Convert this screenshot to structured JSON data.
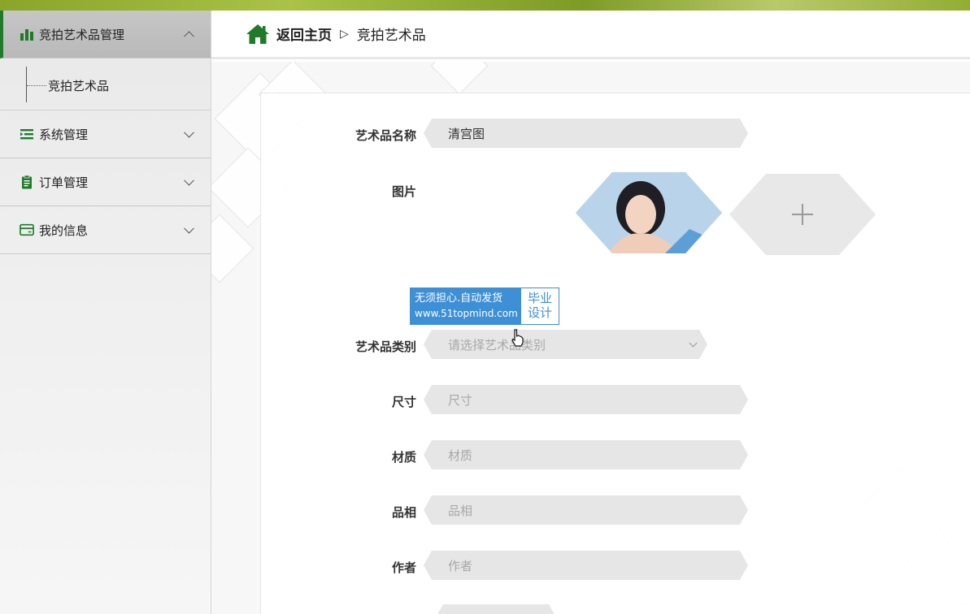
{
  "sidebar": {
    "menus": [
      {
        "label": "竞拍艺术品管理",
        "icon": "bar-chart-icon",
        "expanded": true,
        "children": [
          {
            "label": "竞拍艺术品"
          }
        ]
      },
      {
        "label": "系统管理",
        "icon": "list-indent-icon",
        "expanded": false
      },
      {
        "label": "订单管理",
        "icon": "clipboard-icon",
        "expanded": false
      },
      {
        "label": "我的信息",
        "icon": "card-icon",
        "expanded": false
      }
    ]
  },
  "header": {
    "home_label": "返回主页",
    "separator": "▷",
    "current": "竞拍艺术品"
  },
  "form": {
    "name": {
      "label": "艺术品名称",
      "value": "清宫图"
    },
    "image": {
      "label": "图片"
    },
    "category": {
      "label": "艺术品类别",
      "placeholder": "请选择艺术品类别"
    },
    "size": {
      "label": "尺寸",
      "placeholder": "尺寸"
    },
    "material": {
      "label": "材质",
      "placeholder": "材质"
    },
    "appearance": {
      "label": "品相",
      "placeholder": "品相"
    },
    "author": {
      "label": "作者",
      "placeholder": "作者"
    }
  },
  "watermark": {
    "line1": "无须担心.自动发货",
    "line2": "www.51topmind.com",
    "side1": "毕业",
    "side2": "设计"
  },
  "colors": {
    "accent": "#1f7a2a",
    "watermark": "#3d8fd6"
  }
}
